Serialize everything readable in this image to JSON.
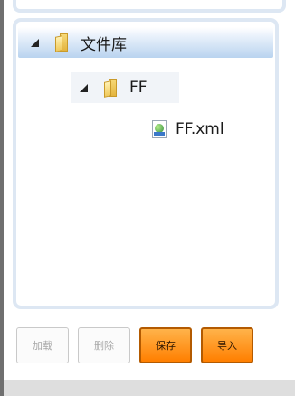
{
  "tree": {
    "root": {
      "label": "文件库"
    },
    "child": {
      "label": "FF"
    },
    "leaf": {
      "label": "FF.xml"
    }
  },
  "buttons": {
    "load": "加载",
    "delete": "删除",
    "save": "保存",
    "import": "导入"
  }
}
